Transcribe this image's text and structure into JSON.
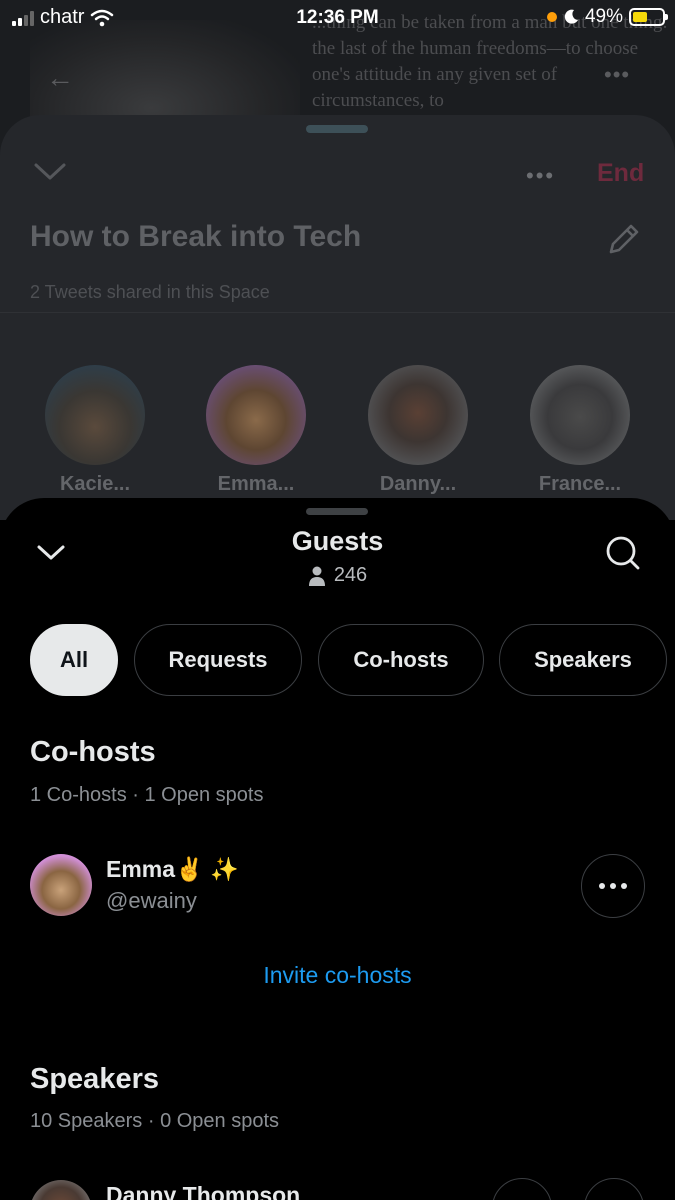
{
  "status_bar": {
    "carrier": "chatr",
    "time": "12:36 PM",
    "battery": "49%",
    "battery_level": 0.49
  },
  "background": {
    "quote_text": "...thing can be taken from a man but one thing: the last of the human freedoms—to choose one's attitude in any given set of circumstances, to"
  },
  "space": {
    "end_label": "End",
    "title": "How to Break into Tech",
    "tweets_shared": "2 Tweets shared in this Space",
    "speakers": [
      {
        "name": "Kacie..."
      },
      {
        "name": "Emma..."
      },
      {
        "name": "Danny..."
      },
      {
        "name": "France..."
      }
    ]
  },
  "guests": {
    "title": "Guests",
    "count": "246",
    "tabs": [
      {
        "label": "All",
        "active": true
      },
      {
        "label": "Requests",
        "active": false
      },
      {
        "label": "Co-hosts",
        "active": false
      },
      {
        "label": "Speakers",
        "active": false
      }
    ],
    "cohosts": {
      "title": "Co-hosts",
      "subtitle": "1 Co-hosts · 1 Open spots",
      "users": [
        {
          "name": "Emma✌️ ✨",
          "handle": "@ewainy"
        }
      ],
      "invite_label": "Invite co-hosts"
    },
    "speakers": {
      "title": "Speakers",
      "subtitle": "10 Speakers · 0 Open spots",
      "users": [
        {
          "name": "Danny Thompson"
        }
      ]
    }
  },
  "colors": {
    "accent": "#1d9bf0",
    "end_red": "#6e2a3d",
    "sheet_bg": "#000000",
    "card_bg": "#25272b"
  }
}
